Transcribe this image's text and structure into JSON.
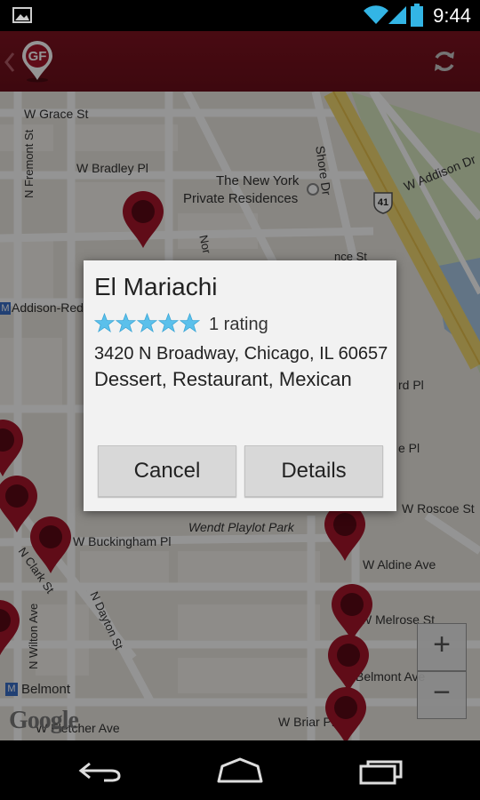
{
  "status_bar": {
    "time": "9:44",
    "icons": [
      "image-notification-icon",
      "wifi-icon",
      "signal-icon",
      "battery-icon"
    ]
  },
  "action_bar": {
    "logo_text": "GF",
    "icons": [
      "up-caret-icon",
      "refresh-icon"
    ]
  },
  "map": {
    "streets": [
      "W Grace St",
      "W Bradley Pl",
      "N Fremont St",
      "Shore Dr",
      "W Addison Dr",
      "The New York",
      "Private Residences",
      "Nor",
      "nce St",
      "rd Pl",
      "e Pl",
      "W Roscoe St",
      "Wendt Playlot Park",
      "W Buckingham Pl",
      "N Clark St",
      "N Dayton St",
      "W Aldine Ave",
      "W Melrose St",
      "Belmont Ave",
      "N Wilton Ave",
      "W Briar Pl",
      "W Fletcher Ave"
    ],
    "highway_shield": "41",
    "transit_stations": [
      "Addison-Red",
      "Belmont"
    ],
    "transit_badge": "M",
    "watermark": "Google",
    "zoom_in": "+",
    "zoom_out": "−",
    "pin_color": "#a6152a",
    "highway_color": "#f2d770"
  },
  "dialog": {
    "name": "El Mariachi",
    "rating_stars": 5,
    "rating_count_text": "1 rating",
    "address": "3420 N Broadway, Chicago, IL 60657",
    "categories": "Dessert, Restaurant, Mexican",
    "cancel_label": "Cancel",
    "details_label": "Details",
    "star_color": "#5bc0eb"
  },
  "nav_bar": {
    "icons": [
      "back-icon",
      "home-icon",
      "recent-apps-icon"
    ]
  }
}
